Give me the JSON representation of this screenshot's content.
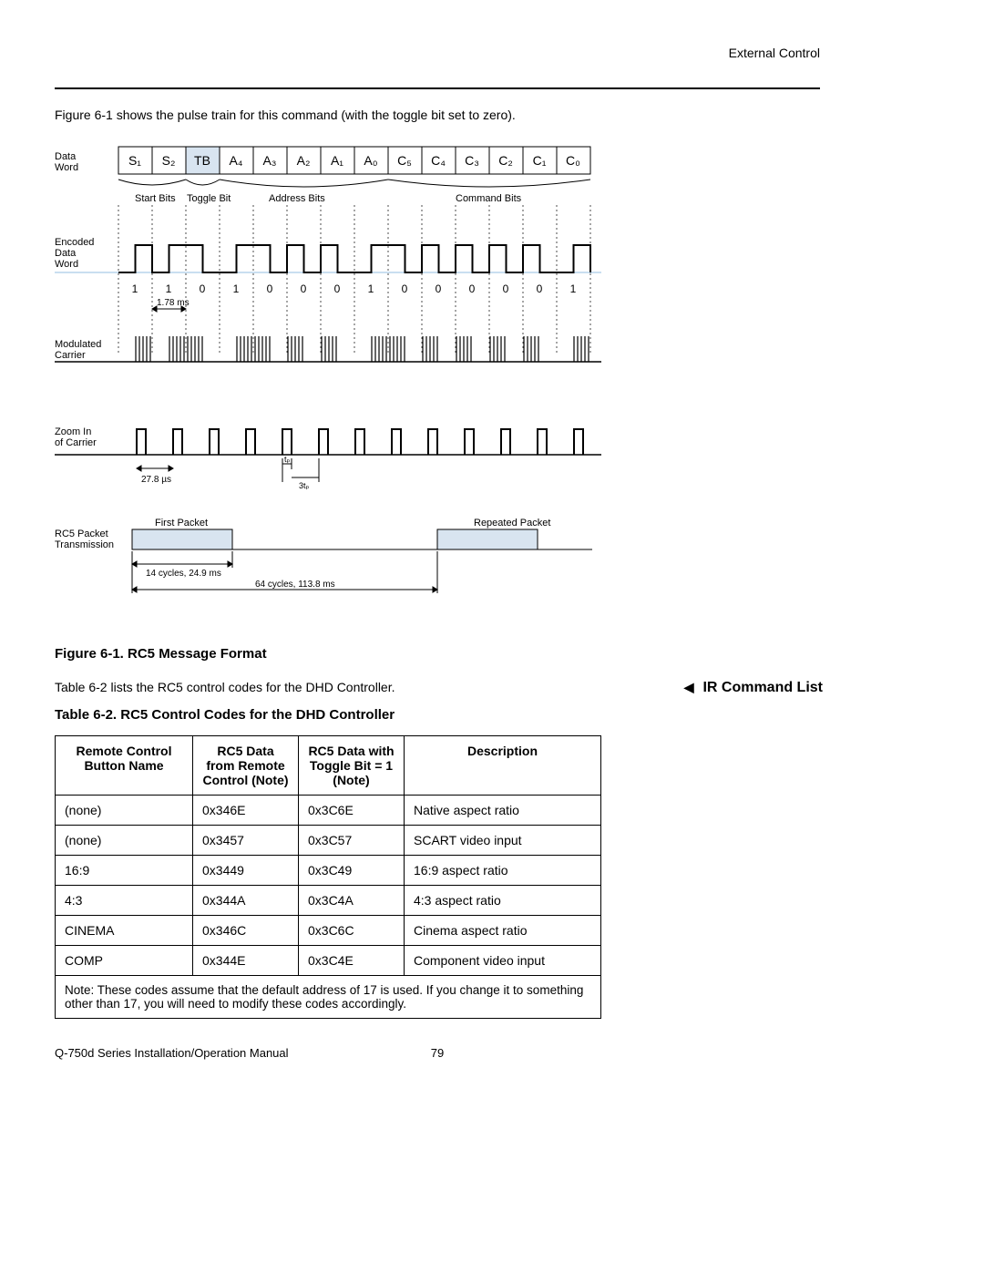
{
  "header": {
    "section": "External Control"
  },
  "intro": "Figure 6-1 shows the pulse train for this command (with the toggle bit set to zero).",
  "diagram": {
    "labels": {
      "data_word": "Data\nWord",
      "encoded_data_word": "Encoded\nData\nWord",
      "modulated_carrier": "Modulated\nCarrier",
      "zoom_in": "Zoom In\nof Carrier",
      "rc5_packet": "RC5 Packet\nTransmission",
      "start_bits": "Start Bits",
      "toggle_bit": "Toggle Bit",
      "address_bits": "Address Bits",
      "command_bits": "Command Bits",
      "first_packet": "First Packet",
      "repeated_packet": "Repeated Packet",
      "t178": "1.78 ms",
      "t278": "27.8 µs",
      "tp": "tₚ",
      "t3p": "3tₚ",
      "cycles14": "14 cycles, 24.9 ms",
      "cycles64": "64 cycles,  113.8 ms"
    },
    "word_cells": [
      "S₁",
      "S₂",
      "TB",
      "A₄",
      "A₃",
      "A₂",
      "A₁",
      "A₀",
      "C₅",
      "C₄",
      "C₃",
      "C₂",
      "C₁",
      "C₀"
    ],
    "bit_sequence": [
      "1",
      "1",
      "0",
      "1",
      "0",
      "0",
      "0",
      "1",
      "0",
      "0",
      "0",
      "0",
      "0",
      "1"
    ]
  },
  "figure_caption": "Figure 6-1. RC5 Message Format",
  "ref_text": "Table 6-2 lists the RC5 control codes for the DHD Controller.",
  "side_label": "IR Command List",
  "table_title": "Table 6-2. RC5 Control Codes for the DHD Controller",
  "table": {
    "headers": [
      "Remote Control Button Name",
      "RC5 Data from Remote Control (Note)",
      "RC5 Data with Toggle Bit = 1 (Note)",
      "Description"
    ],
    "rows": [
      [
        "(none)",
        "0x346E",
        "0x3C6E",
        "Native aspect ratio"
      ],
      [
        "(none)",
        "0x3457",
        "0x3C57",
        "SCART video input"
      ],
      [
        "16:9",
        "0x3449",
        "0x3C49",
        "16:9 aspect ratio"
      ],
      [
        "4:3",
        "0x344A",
        "0x3C4A",
        "4:3 aspect ratio"
      ],
      [
        "CINEMA",
        "0x346C",
        "0x3C6C",
        "Cinema aspect ratio"
      ],
      [
        "COMP",
        "0x344E",
        "0x3C4E",
        "Component video input"
      ]
    ],
    "note": "Note:  These codes assume that the default address of 17 is used. If you change it to something other than 17, you will need to modify these codes accordingly."
  },
  "footer": {
    "manual": "Q-750d Series Installation/Operation Manual",
    "page": "79"
  }
}
